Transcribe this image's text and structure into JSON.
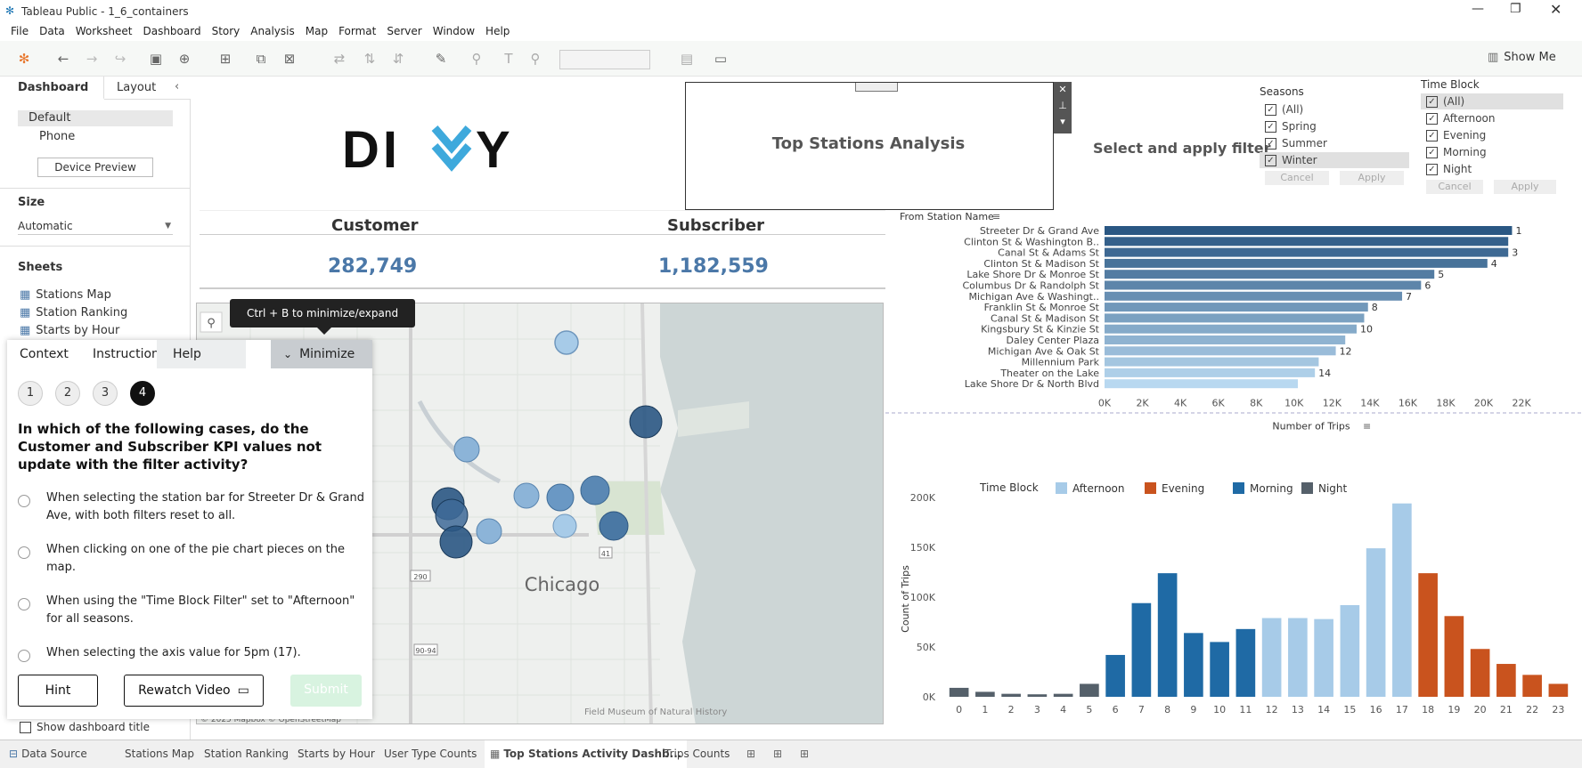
{
  "window": {
    "title": "Tableau Public - 1_6_containers"
  },
  "menu": [
    "File",
    "Data",
    "Worksheet",
    "Dashboard",
    "Story",
    "Analysis",
    "Map",
    "Format",
    "Server",
    "Window",
    "Help"
  ],
  "toolbar": {
    "show_me": "Show Me"
  },
  "side": {
    "tab_dashboard": "Dashboard",
    "tab_layout": "Layout",
    "device_default": "Default",
    "device_phone": "Phone",
    "device_preview": "Device Preview",
    "size_title": "Size",
    "size_value": "Automatic",
    "sheets_title": "Sheets",
    "sheets": [
      "Stations Map",
      "Station Ranking",
      "Starts by Hour"
    ],
    "show_title": "Show dashboard title"
  },
  "dashboard": {
    "logo": "DIVVY",
    "container_title": "Top Stations Analysis",
    "select_filter": "Select and apply filter",
    "kpi_customer_label": "Customer",
    "kpi_customer_value": "282,749",
    "kpi_subscriber_label": "Subscriber",
    "kpi_subscriber_value": "1,182,559",
    "tooltip": "Ctrl + B to minimize/expand",
    "map_city": "Chicago",
    "map_credit": "© 2025 Mapbox © OpenStreetMap",
    "map_poi": "Field Museum of Natural History",
    "route_41": "41",
    "route_290": "290",
    "route_9094": "90-94"
  },
  "filters": {
    "seasons_title": "Seasons",
    "seasons": [
      "(All)",
      "Spring",
      "Summer",
      "Winter"
    ],
    "timeblock_title": "Time Block",
    "timeblocks": [
      "(All)",
      "Afternoon",
      "Evening",
      "Morning",
      "Night"
    ],
    "cancel": "Cancel",
    "apply": "Apply"
  },
  "overlay": {
    "tabs": [
      "Context",
      "Instructions",
      "Help"
    ],
    "minimize": "Minimize",
    "steps": [
      "1",
      "2",
      "3",
      "4"
    ],
    "question": "In which of the following cases, do the Customer and Subscriber KPI values not update with the filter activity?",
    "options": [
      "When selecting the station bar for Streeter Dr & Grand Ave, with both filters reset to all.",
      "When clicking on one of the pie chart pieces on the map.",
      "When using the \"Time Block Filter\" set to \"Afternoon\" for all seasons.",
      "When selecting the axis value for 5pm (17)."
    ],
    "hint": "Hint",
    "rewatch": "Rewatch Video",
    "submit": "Submit"
  },
  "bottom_tabs": [
    "Data Source",
    "Stations Map",
    "Station Ranking",
    "Starts by Hour",
    "User Type Counts",
    "Top Stations Activity Dashb...",
    "Trips Counts"
  ],
  "chart_data": [
    {
      "type": "bar",
      "orientation": "horizontal",
      "title": "From Station Name",
      "xlabel": "Number of Trips",
      "categories": [
        "Streeter Dr & Grand Ave",
        "Clinton St & Washington B..",
        "Canal St & Adams St",
        "Clinton St & Madison St",
        "Lake Shore Dr & Monroe St",
        "Columbus Dr & Randolph St",
        "Michigan Ave & Washingt..",
        "Franklin St & Monroe St",
        "Canal St & Madison St",
        "Kingsbury St & Kinzie St",
        "Daley Center Plaza",
        "Michigan Ave & Oak St",
        "Millennium Park",
        "Theater on the Lake",
        "Lake Shore Dr & North Blvd"
      ],
      "values": [
        21500,
        21300,
        21300,
        20200,
        17400,
        16700,
        15700,
        13900,
        13700,
        13300,
        12700,
        12200,
        11300,
        11100,
        10200
      ],
      "rank_labels": [
        "1",
        "",
        "3",
        "4",
        "5",
        "6",
        "7",
        "8",
        "",
        "10",
        "",
        "12",
        "",
        "14",
        ""
      ],
      "xticks": [
        "0K",
        "2K",
        "4K",
        "6K",
        "8K",
        "10K",
        "12K",
        "14K",
        "16K",
        "18K",
        "20K",
        "22K"
      ],
      "xlim": [
        0,
        23500
      ],
      "colors": {
        "dark": "#2a5783",
        "light": "#b8d8f0"
      }
    },
    {
      "type": "bar",
      "xlabel": "",
      "ylabel": "Count of Trips",
      "legend_title": "Time Block",
      "legend_position": "top",
      "categories": [
        "0",
        "1",
        "2",
        "3",
        "4",
        "5",
        "6",
        "7",
        "8",
        "9",
        "10",
        "11",
        "12",
        "13",
        "14",
        "15",
        "16",
        "17",
        "18",
        "19",
        "20",
        "21",
        "22",
        "23"
      ],
      "values": [
        9000,
        5000,
        3000,
        2500,
        3000,
        13000,
        42000,
        94000,
        124000,
        64000,
        55000,
        68000,
        79000,
        79000,
        78000,
        92000,
        149000,
        194000,
        124000,
        81000,
        48000,
        33000,
        22000,
        13000
      ],
      "groups": [
        "Night",
        "Night",
        "Night",
        "Night",
        "Night",
        "Night",
        "Morning",
        "Morning",
        "Morning",
        "Morning",
        "Morning",
        "Morning",
        "Afternoon",
        "Afternoon",
        "Afternoon",
        "Afternoon",
        "Afternoon",
        "Afternoon",
        "Evening",
        "Evening",
        "Evening",
        "Evening",
        "Evening",
        "Evening"
      ],
      "series": [
        {
          "name": "Afternoon",
          "color": "#a7cbe8"
        },
        {
          "name": "Evening",
          "color": "#c9531e"
        },
        {
          "name": "Morning",
          "color": "#1f6aa5"
        },
        {
          "name": "Night",
          "color": "#55606a"
        }
      ],
      "yticks": [
        "0K",
        "50K",
        "100K",
        "150K",
        "200K"
      ],
      "ylim": [
        0,
        200000
      ]
    }
  ]
}
